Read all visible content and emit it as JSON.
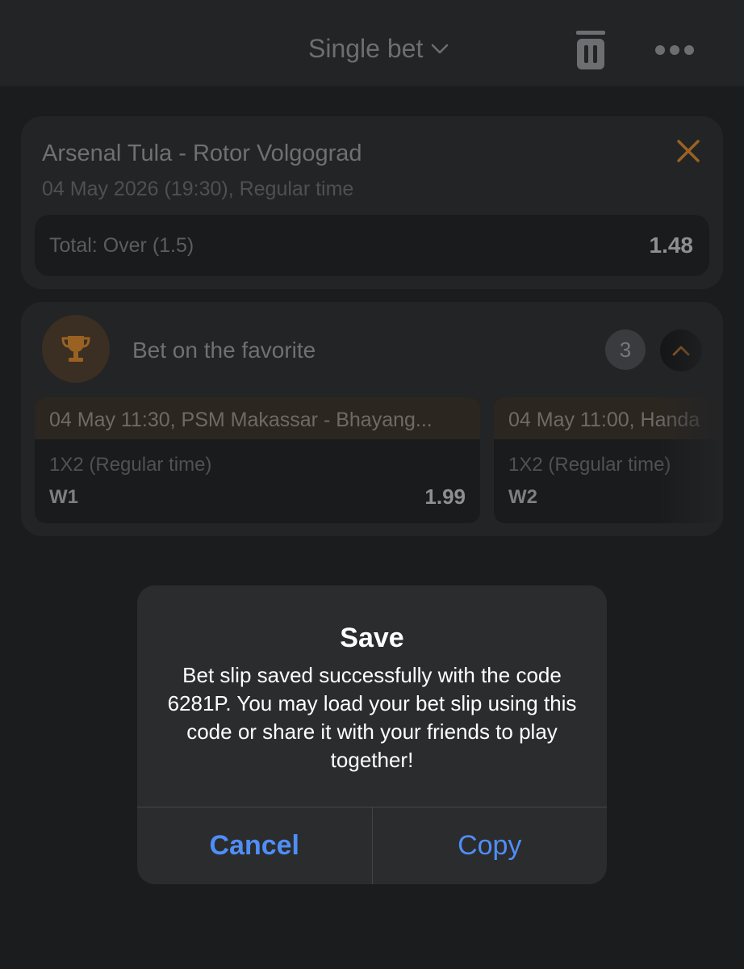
{
  "header": {
    "title": "Single bet",
    "icons": [
      "chevron-down-icon",
      "trash-icon",
      "more-icon"
    ]
  },
  "bet": {
    "match": "Arsenal Tula - Rotor Volgograd",
    "datetime": "04 May 2026 (19:30), Regular time",
    "outcome": "Total: Over (1.5)",
    "odds": "1.48",
    "close_icon_color": "#c77a24"
  },
  "favorite": {
    "title": "Bet on the favorite",
    "count": "3",
    "accent_color": "#c77a24",
    "cards": [
      {
        "header": "04 May 11:30, PSM Makassar - Bhayang...",
        "market": "1X2 (Regular time)",
        "outcome": "W1",
        "odds": "1.99"
      },
      {
        "header": "04 May 11:00, Handa",
        "market": "1X2 (Regular time)",
        "outcome": "W2",
        "odds": ""
      }
    ]
  },
  "dialog": {
    "title": "Save",
    "message": "Bet slip saved successfully with the code 6281P. You may load your bet slip using this code or share it with your friends to play together!",
    "cancel_label": "Cancel",
    "copy_label": "Copy",
    "button_color": "#4f8ef7"
  }
}
